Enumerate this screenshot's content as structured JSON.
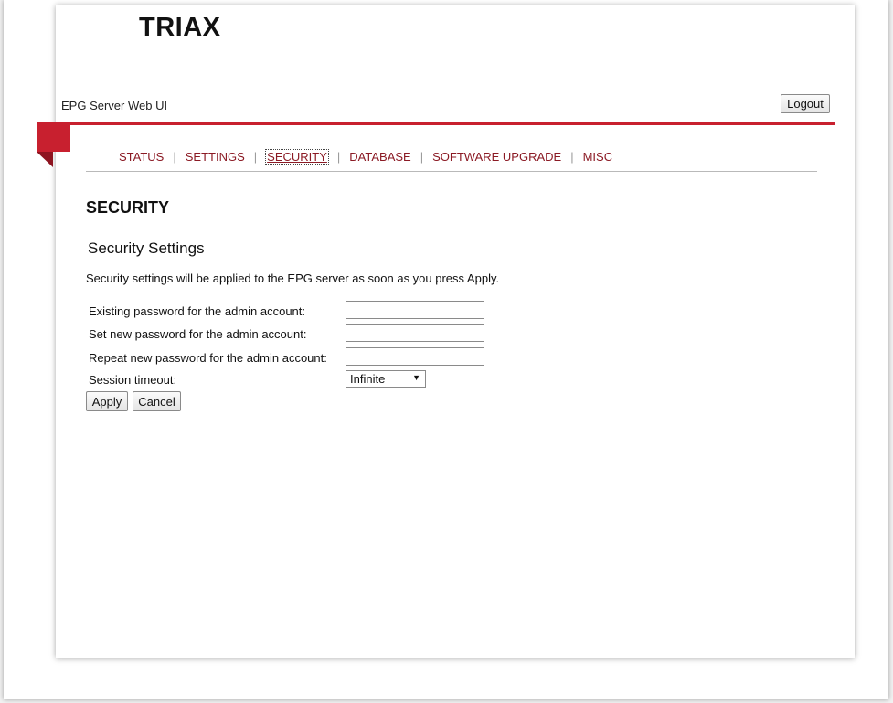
{
  "header": {
    "logo_text": "TRIAX",
    "app_title": "EPG Server Web UI",
    "logout_label": "Logout"
  },
  "nav": {
    "items": [
      {
        "label": "STATUS",
        "active": false
      },
      {
        "label": "SETTINGS",
        "active": false
      },
      {
        "label": "SECURITY",
        "active": true
      },
      {
        "label": "DATABASE",
        "active": false
      },
      {
        "label": "SOFTWARE UPGRADE",
        "active": false
      },
      {
        "label": "MISC",
        "active": false
      }
    ],
    "separator": "|"
  },
  "main": {
    "page_heading": "SECURITY",
    "section_title": "Security Settings",
    "description": "Security settings will be applied to the EPG server as soon as you press Apply.",
    "form": {
      "existing_password_label": "Existing password for the admin account:",
      "existing_password_value": "",
      "new_password_label": "Set new password for the admin account:",
      "new_password_value": "",
      "repeat_password_label": "Repeat new password for the admin account:",
      "repeat_password_value": "",
      "session_timeout_label": "Session timeout:",
      "session_timeout_value": "Infinite",
      "apply_label": "Apply",
      "cancel_label": "Cancel"
    }
  },
  "colors": {
    "accent": "#c8202f",
    "accent_dark": "#8e1420",
    "nav_link": "#8b1a24"
  },
  "icons": {
    "dropdown": "chevron-down-icon"
  }
}
